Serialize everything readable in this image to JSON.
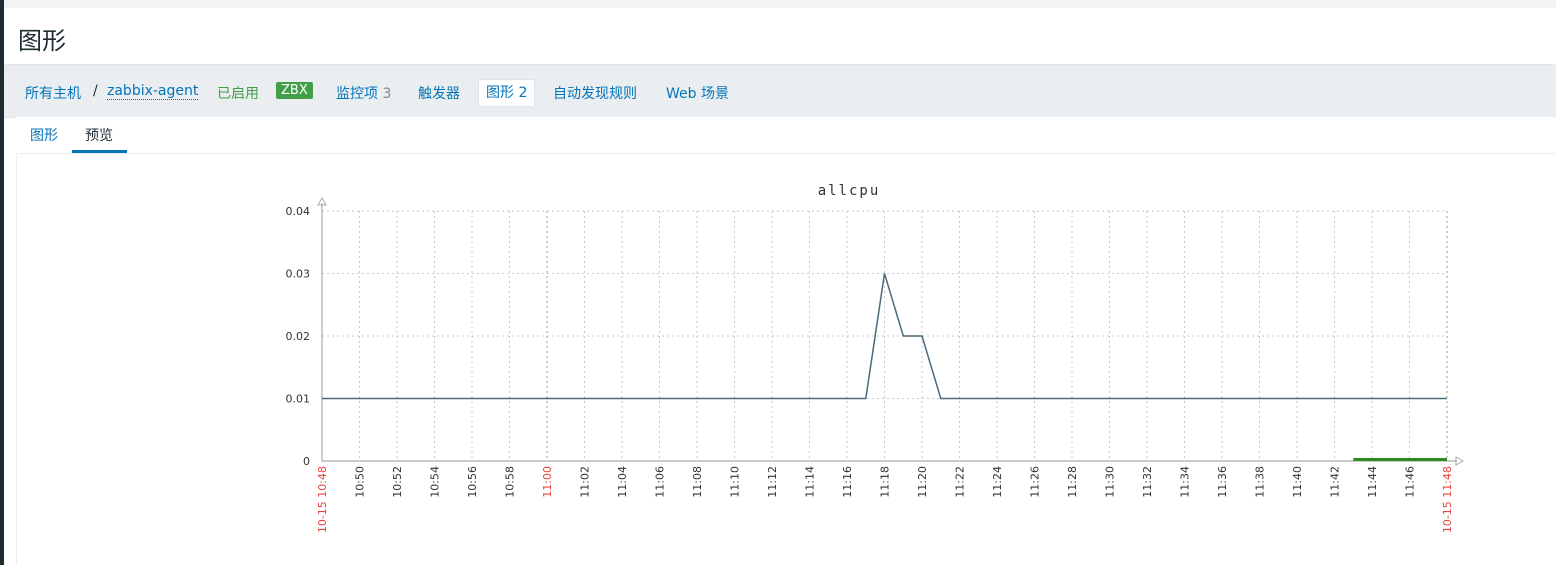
{
  "page": {
    "title": "图形"
  },
  "breadcrumb": {
    "all_hosts": "所有主机",
    "separator": "/",
    "host": "zabbix-agent"
  },
  "host_nav": {
    "status": "已启用",
    "badge": "ZBX",
    "items_label": "监控项",
    "items_count": "3",
    "triggers_label": "触发器",
    "graphs_label": "图形",
    "graphs_count": "2",
    "discovery_label": "自动发现规则",
    "web_label": "Web 场景"
  },
  "subtabs": {
    "graph": "图形",
    "preview": "预览"
  },
  "colors": {
    "accent": "#0275b8",
    "green": "#429e47",
    "line": "#4a6a7a",
    "trigger": "#2f8a1f",
    "red_label": "#e8453c"
  },
  "chart_data": {
    "type": "line",
    "title": "allcpu",
    "ylim": [
      0,
      0.04
    ],
    "y_ticks": [
      "0",
      "0.01",
      "0.02",
      "0.03",
      "0.04"
    ],
    "x_tick_labels": [
      "10-15 10:48",
      "10:50",
      "10:52",
      "10:54",
      "10:56",
      "10:58",
      "11:00",
      "11:02",
      "11:04",
      "11:06",
      "11:08",
      "11:10",
      "11:12",
      "11:14",
      "11:16",
      "11:18",
      "11:20",
      "11:22",
      "11:24",
      "11:26",
      "11:28",
      "11:30",
      "11:32",
      "11:34",
      "11:36",
      "11:38",
      "11:40",
      "11:42",
      "11:44",
      "11:46",
      "10-15 11:48"
    ],
    "red_ticks": [
      "10-15 10:48",
      "11:00",
      "10-15 11:48"
    ],
    "xlim_minutes": [
      0,
      60
    ],
    "grid": true,
    "series": [
      {
        "x_minutes": [
          0,
          29,
          30,
          31,
          32,
          33,
          60
        ],
        "values": [
          0.01,
          0.01,
          0.03,
          0.02,
          0.02,
          0.01,
          0.01
        ]
      }
    ],
    "trigger_bar_minutes": [
      55,
      60
    ]
  }
}
